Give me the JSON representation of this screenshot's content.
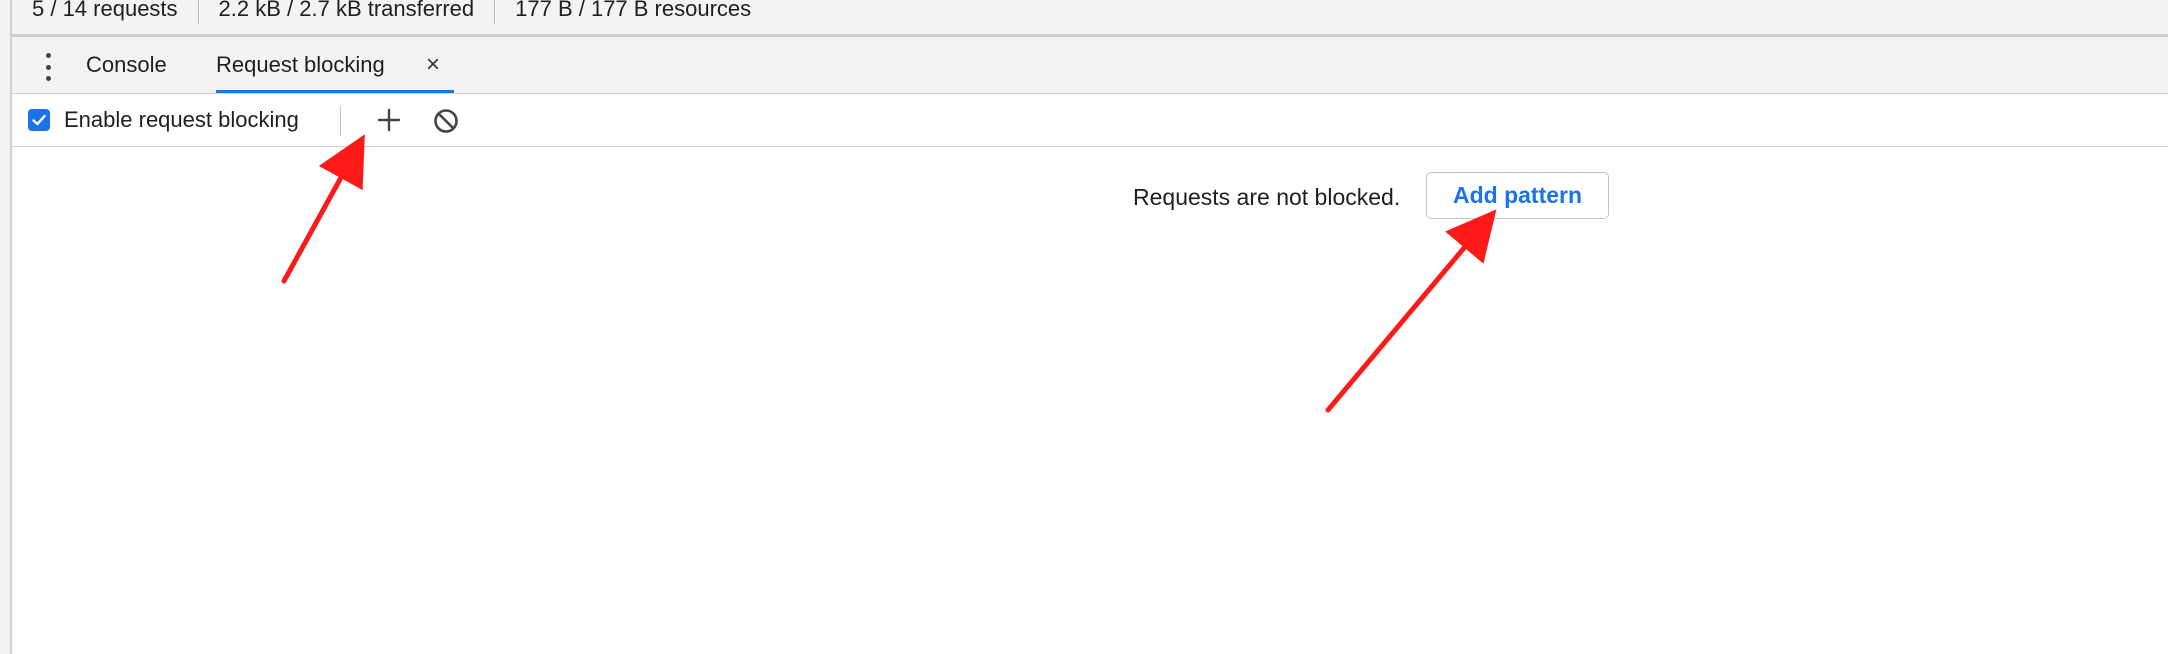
{
  "summary": {
    "requests": "5 / 14 requests",
    "transferred": "2.2 kB / 2.7 kB transferred",
    "resources": "177 B / 177 B resources"
  },
  "tabs": {
    "console_label": "Console",
    "request_blocking_label": "Request blocking",
    "close_glyph": "×"
  },
  "toolbar": {
    "enable_label": "Enable request blocking",
    "enable_checked": true
  },
  "main": {
    "empty_message": "Requests are not blocked.",
    "add_pattern_label": "Add pattern"
  },
  "icons": [
    "more-vert-icon",
    "close-icon",
    "checkmark-icon",
    "plus-icon",
    "clear-blocked-icon",
    "arrow-annotation"
  ],
  "colors": {
    "accent": "#1a73e8",
    "annotation_arrow": "#ff1a1a"
  }
}
